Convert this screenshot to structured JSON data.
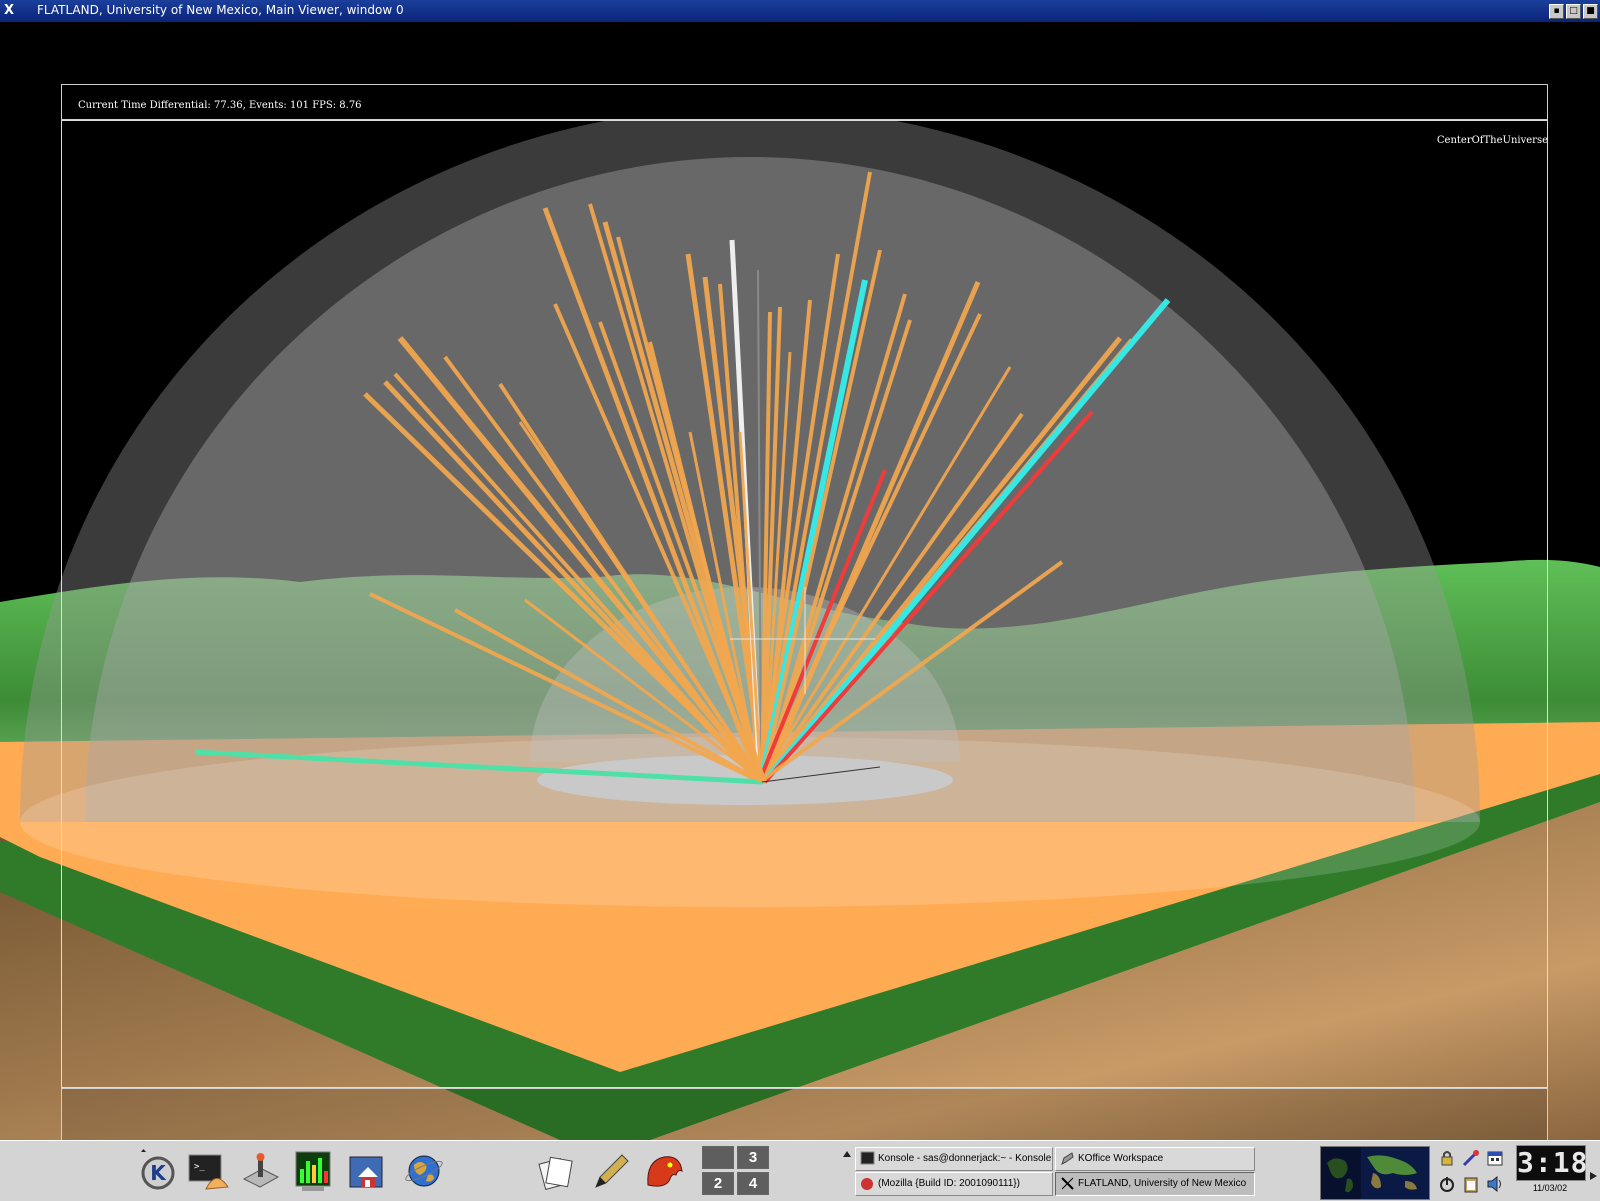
{
  "window": {
    "title": "FLATLAND, University of New Mexico, Main Viewer, window 0",
    "menu_glyph": "X"
  },
  "viewer": {
    "status_text": "Current Time Differential: 77.36, Events: 101 FPS: 8.76",
    "center_label": "CenterOfTheUniverse"
  },
  "taskbar": {
    "launchers": [
      "kde-menu-icon",
      "konsole-shell-icon",
      "control-center-icon",
      "system-monitor-icon",
      "home-folder-icon",
      "web-browser-globe-icon",
      "office-files-icon",
      "pen-editor-icon",
      "mozilla-icon"
    ],
    "desktops": [
      "3",
      "2",
      "4"
    ],
    "active_desktop_index": 1,
    "tasks": [
      {
        "label": "Konsole - sas@donnerjack:~ - Konsole",
        "icon": "konsole-icon"
      },
      {
        "label": "KOffice Workspace",
        "icon": "koffice-icon"
      },
      {
        "label": "(Mozilla {Build ID: 2001090111})",
        "icon": "mozilla-icon"
      },
      {
        "label": "FLATLAND, University of New Mexico",
        "icon": "x-icon"
      }
    ],
    "tray": [
      "lock-icon",
      "network-icon",
      "calendar-icon",
      "power-icon",
      "clipboard-icon",
      "volume-icon"
    ],
    "clock": "3:18",
    "date": "11/03/02"
  },
  "colors": {
    "title_bar": "#1b3f9c",
    "floor": "#ffab54",
    "terrain": "#3f8f3a",
    "dome": "#8c8c8c",
    "ray_orange": "#f3a74e",
    "ray_cyan": "#36e7e4",
    "ray_red": "#f13a3a",
    "ray_white": "#eeeeee"
  }
}
